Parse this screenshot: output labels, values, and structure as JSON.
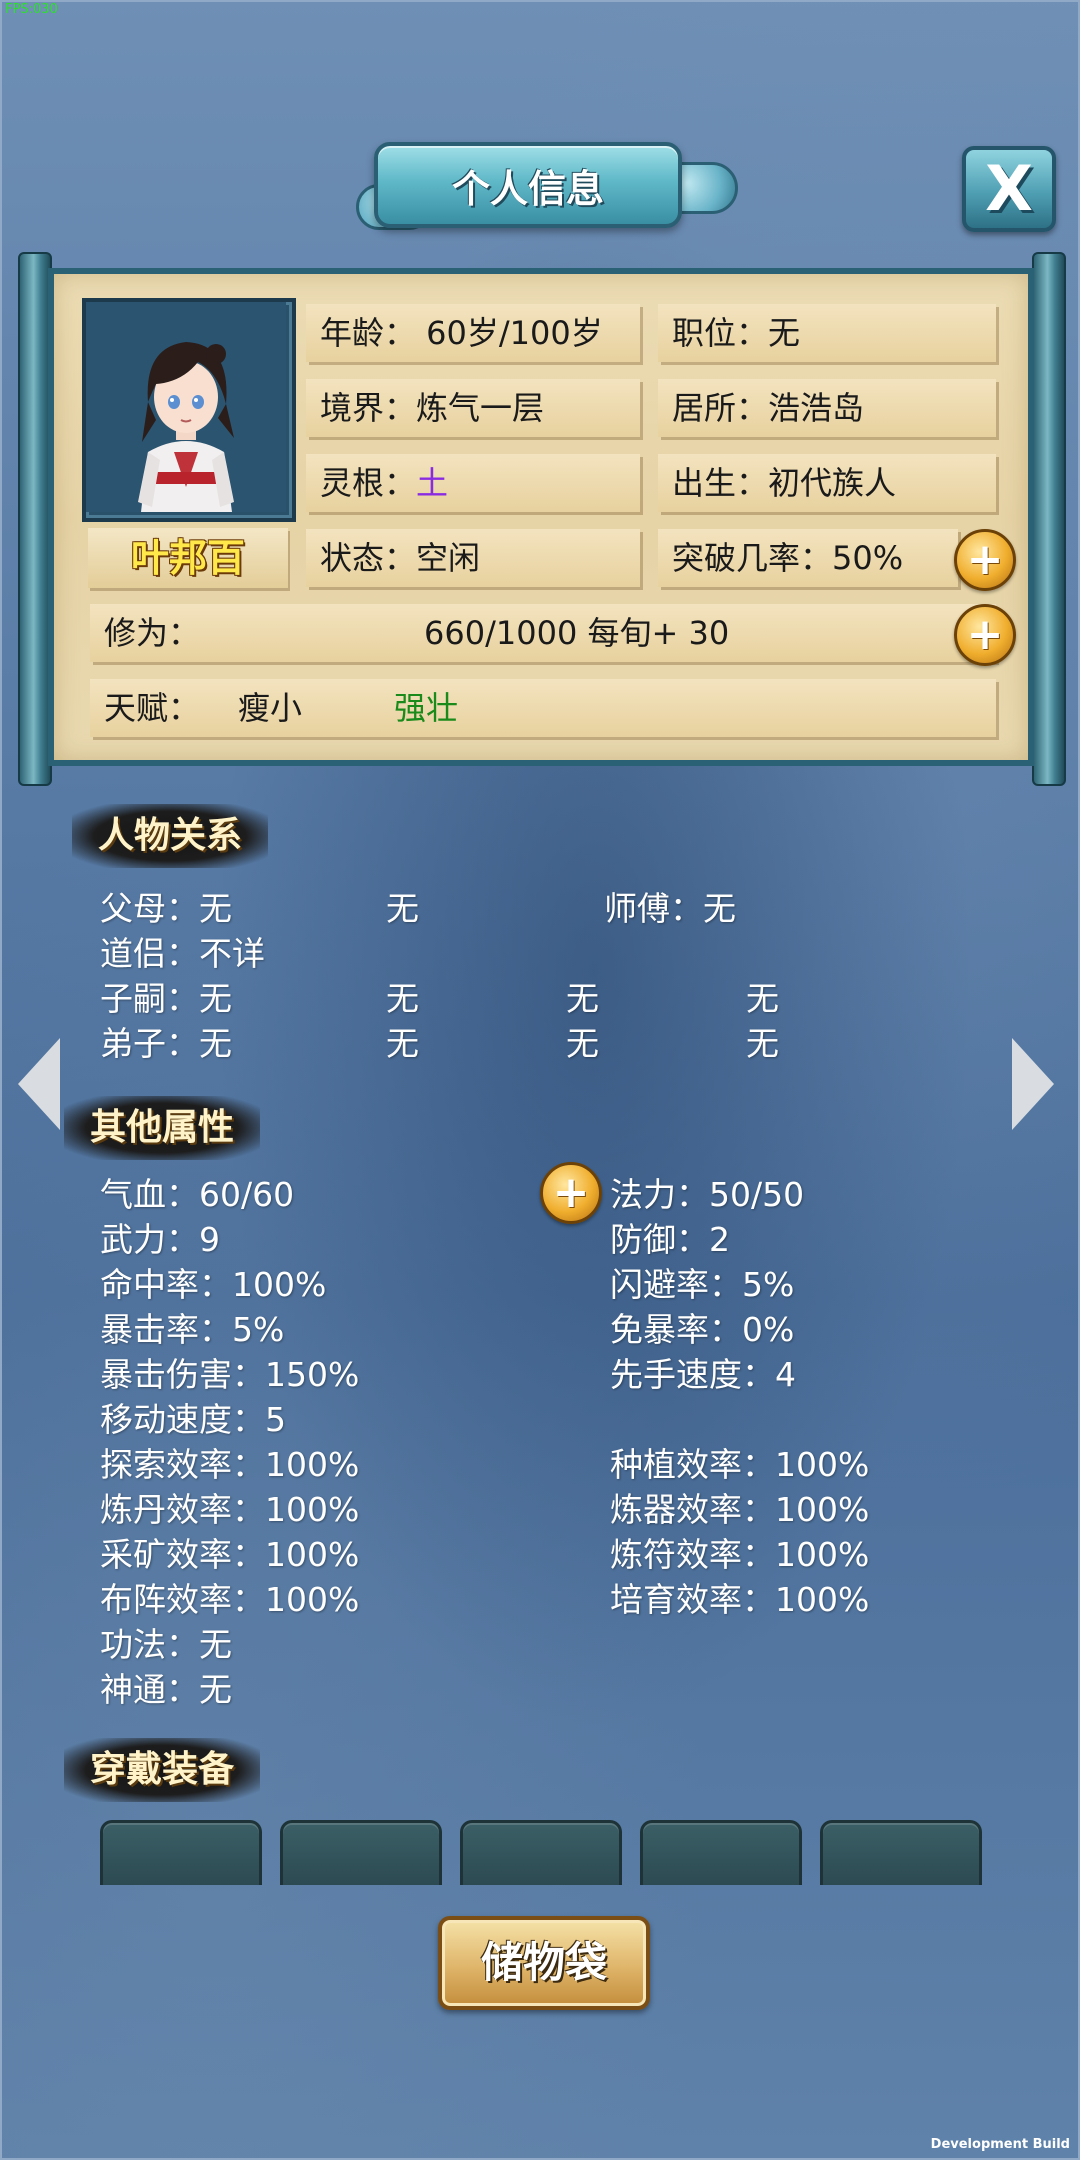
{
  "overlay": {
    "fps": "FPS:030",
    "dev_build": "Development Build"
  },
  "header": {
    "title": "个人信息",
    "close_label": "X"
  },
  "character": {
    "name": "叶邦百",
    "age": "年龄：  60岁/100岁",
    "position": "职位：无",
    "realm": "境界：炼气一层",
    "residence": "居所：浩浩岛",
    "root_label": "灵根：",
    "root_value": "土",
    "birth": "出生：初代族人",
    "status": "状态：空闲",
    "breakthrough": "突破几率：50%",
    "cultivation_label": "修为：",
    "cultivation_value": "660/1000  每旬+ 30",
    "talent_label": "天赋：",
    "talent_1": "瘦小",
    "talent_2": "强壮"
  },
  "relations": {
    "header": "人物关系",
    "rows": [
      {
        "label": "父母：无",
        "c2": "无",
        "c3": "师傅：无",
        "c4": ""
      },
      {
        "label": "道侣：不详",
        "c2": "",
        "c3": "",
        "c4": ""
      },
      {
        "label": "子嗣：无",
        "c2": "无",
        "c3": "无",
        "c4": "无"
      },
      {
        "label": "弟子：无",
        "c2": "无",
        "c3": "无",
        "c4": "无"
      }
    ]
  },
  "attributes": {
    "header": "其他属性",
    "left": [
      "气血：60/60",
      "武力：9",
      "命中率：100%",
      "暴击率：5%",
      "暴击伤害：150%",
      "移动速度：5",
      "探索效率：100%",
      "炼丹效率：100%",
      "采矿效率：100%",
      "布阵效率：100%",
      "功法：无",
      "神通：无"
    ],
    "right": [
      "法力：50/50",
      "防御：2",
      "闪避率：5%",
      "免暴率：0%",
      "先手速度：4",
      "",
      "种植效率：100%",
      "炼器效率：100%",
      "炼符效率：100%",
      "培育效率：100%"
    ]
  },
  "equipment": {
    "header": "穿戴装备"
  },
  "storage_button": "储物袋",
  "colors": {
    "root_value": "#8a2be2",
    "talent_2": "#1a8a1a"
  },
  "icons": {
    "plus": "plus-circle-icon",
    "close": "close-icon",
    "prev": "chevron-left-icon",
    "next": "chevron-right-icon"
  }
}
